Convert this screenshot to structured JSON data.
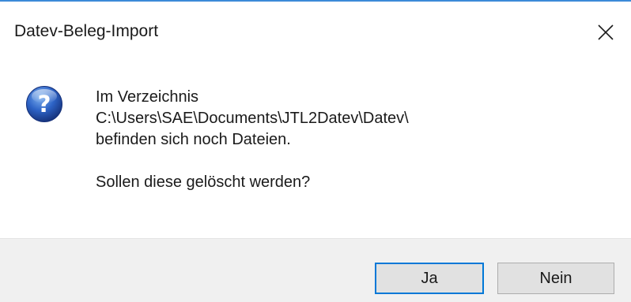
{
  "window": {
    "title": "Datev-Beleg-Import",
    "accent_color": "#3c8ad8",
    "close_icon": "close-icon"
  },
  "message": {
    "icon": "question-icon",
    "lines": [
      "Im Verzeichnis",
      "C:\\Users\\SAE\\Documents\\JTL2Datev\\Datev\\",
      "befinden sich noch Dateien."
    ],
    "question": "Sollen diese gelöscht werden?"
  },
  "buttons": {
    "yes_label": "Ja",
    "no_label": "Nein",
    "default": "Ja",
    "default_border_color": "#0078d7"
  }
}
